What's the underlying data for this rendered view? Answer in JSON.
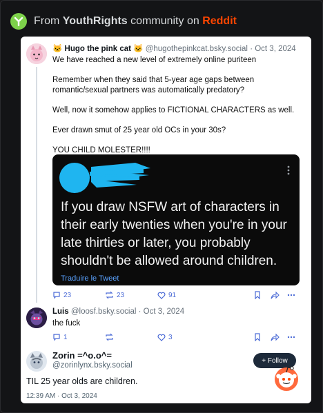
{
  "header": {
    "prefix": "From",
    "community": "YouthRights",
    "middle": "community on",
    "site": "Reddit"
  },
  "post1": {
    "name": "🐱 Hugo the pink cat 🐱",
    "handle": "@hugothepinkcat.bsky.social",
    "date": "· Oct 3, 2024",
    "paragraphs": [
      "We have reached a new level of extremely online puriteen",
      "Remember when they said that 5-year age gaps between romantic/sexual partners was automatically predatory?",
      "Well, now it somehow applies to FICTIONAL CHARACTERS as well.",
      "Ever drawn smut of 25 year old OCs in your 30s?",
      "YOU CHILD MOLESTER!!!!"
    ],
    "embed": {
      "text": "If you draw NSFW art of characters in their early twenties when you're in your late thirties or later, you probably shouldn't be allowed around children.",
      "translate": "Traduire le Tweet"
    },
    "replies": "23",
    "reposts": "23",
    "likes": "91"
  },
  "post2": {
    "name": "Luis",
    "handle": "@loosf.bsky.social",
    "date": "· Oct 3, 2024",
    "text": "the fuck",
    "replies": "1",
    "likes": "3"
  },
  "post3": {
    "name": "Zorin =^o.o^=",
    "handle": "@zorinlynx.bsky.social",
    "follow_label": "+ Follow",
    "text": "TIL 25 year olds are children.",
    "timestamp": "12:39 AM · Oct 3, 2024"
  },
  "colors": {
    "accent": "#4a6ad6",
    "reddit": "#ff4500",
    "logo": "#7dd14a"
  }
}
